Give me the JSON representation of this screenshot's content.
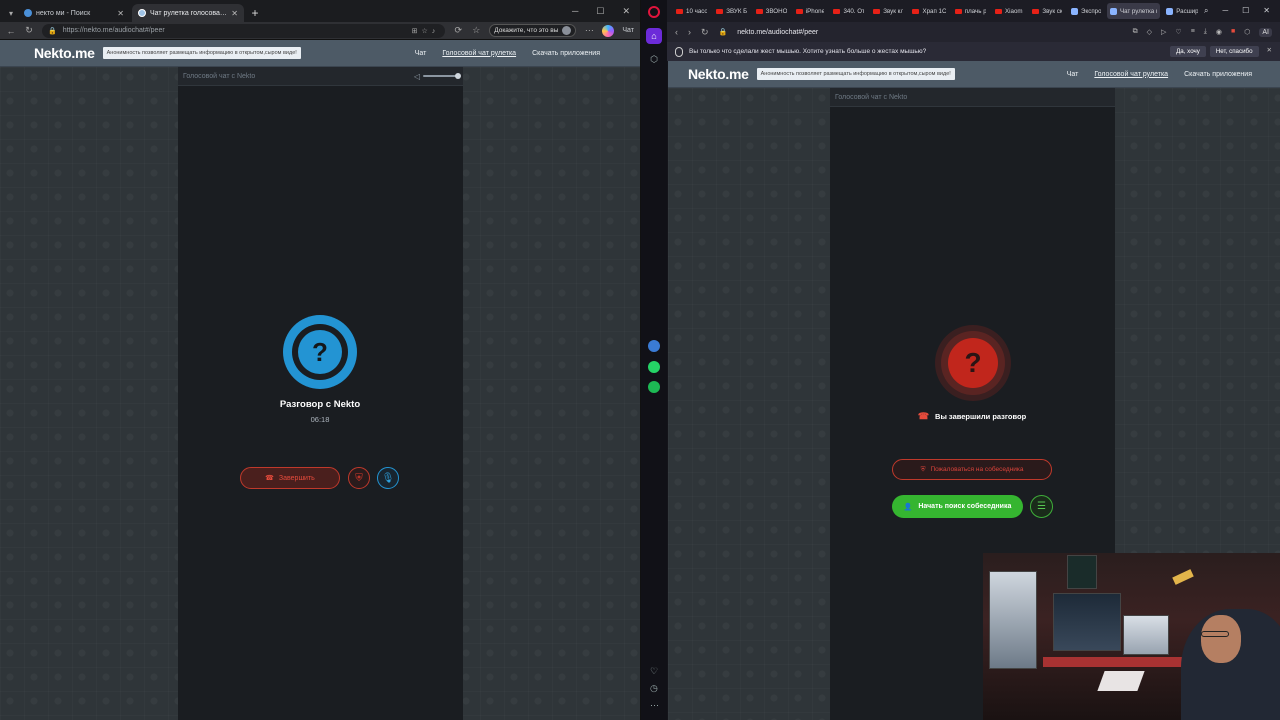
{
  "left_browser": {
    "tabs": [
      {
        "title": "некто ми - Поиск",
        "active": false
      },
      {
        "title": "Чат рулетка голосовая — Nekto",
        "active": true
      }
    ],
    "url": "https://nekto.me/audiochat#/peer",
    "pill_text": "Докажите, что это вы",
    "copilot_label": "Чат"
  },
  "site": {
    "logo": "Nekto.me",
    "notice": "Анонимность позволяет размещать информацию в открытом,сыром виде!",
    "nav": {
      "chat": "Чат",
      "voice_roulette": "Голосовой чат рулетка",
      "download": "Скачать приложения"
    },
    "panel_title": "Голосовой чат с Nekto"
  },
  "left_call": {
    "avatar_glyph": "?",
    "title": "Разговор с Nekto",
    "timer": "06:18",
    "end_button": "Завершить"
  },
  "right_browser": {
    "tabs": [
      "10 часо",
      "ЗВУК Б",
      "ЗВОНО",
      "iPhone",
      "340. От",
      "Звук кл",
      "Храп 1С",
      "плачь р",
      "Xiaomi",
      "Звук ск",
      "Экспро",
      "Чат рулетка г",
      "Расшир"
    ],
    "url": "nekto.me/audiochat#/peer",
    "info_bar": "Вы только что сделали жест мышью. Хотите узнать больше о жестах мышью?",
    "info_yes": "Да, хочу",
    "info_no": "Нет, спасибо",
    "ai_label": "AI"
  },
  "right_call": {
    "avatar_glyph": "?",
    "status": "Вы завершили разговор",
    "report_button": "Пожаловаться на собеседника",
    "search_button": "Начать поиск собеседника"
  },
  "colors": {
    "accent_blue": "#2394d3",
    "danger_red": "#c0392b",
    "success_green": "#35b530",
    "header": "#4d5a66"
  }
}
